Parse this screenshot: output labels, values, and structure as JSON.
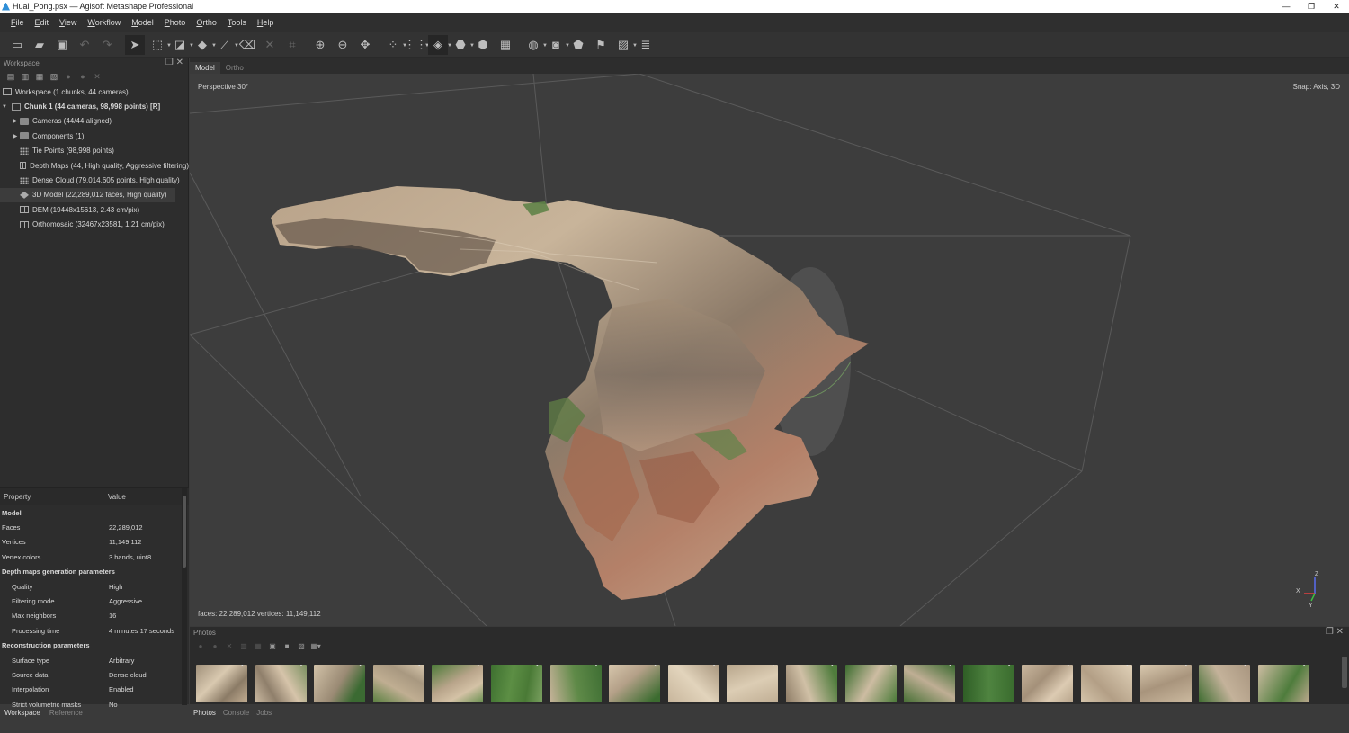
{
  "window": {
    "title": "Huai_Pong.psx — Agisoft Metashape Professional"
  },
  "menu": [
    "File",
    "Edit",
    "View",
    "Workflow",
    "Model",
    "Photo",
    "Ortho",
    "Tools",
    "Help"
  ],
  "toolbar_icons": [
    "new-icon",
    "open-icon",
    "save-icon",
    "undo-icon",
    "redo-icon",
    "navigation-icon",
    "rectangle-selection-icon",
    "shape-icon",
    "polygon-icon",
    "ruler-icon",
    "delete-icon",
    "crop-icon",
    "zoom-in-icon",
    "zoom-out-icon",
    "reset-view-icon",
    "point-cloud-icon",
    "dense-cloud-icon",
    "model-icon",
    "tiled-model-icon",
    "texture-icon",
    "dem-icon",
    "ortho-icon",
    "camera-icon",
    "shapes-icon",
    "markers-icon",
    "image-icon",
    "layers-icon"
  ],
  "workspace": {
    "panel_title": "Workspace",
    "root": "Workspace (1 chunks, 44 cameras)",
    "chunk": "Chunk 1 (44 cameras, 98,998 points) [R]",
    "items": [
      {
        "label": "Cameras (44/44 aligned)",
        "icon": "folder-icon",
        "expandable": true
      },
      {
        "label": "Components (1)",
        "icon": "folder-icon",
        "expandable": true
      },
      {
        "label": "Tie Points (98,998 points)",
        "icon": "tie-points-icon",
        "expandable": false
      },
      {
        "label": "Depth Maps (44, High quality, Aggressive filtering)",
        "icon": "depth-maps-icon",
        "expandable": false
      },
      {
        "label": "Dense Cloud (79,014,605 points, High quality)",
        "icon": "dense-cloud-icon",
        "expandable": false
      },
      {
        "label": "3D Model (22,289,012 faces, High quality)",
        "icon": "model-icon",
        "expandable": false,
        "selected": true
      },
      {
        "label": "DEM (19448x15613, 2.43 cm/pix)",
        "icon": "dem-icon",
        "expandable": false
      },
      {
        "label": "Orthomosaic (32467x23581, 1.21 cm/pix)",
        "icon": "orthomosaic-icon",
        "expandable": false
      }
    ]
  },
  "properties": {
    "col_property": "Property",
    "col_value": "Value",
    "rows": [
      {
        "k": "Model",
        "v": "",
        "type": "grp"
      },
      {
        "k": "Faces",
        "v": "22,289,012",
        "type": "sub"
      },
      {
        "k": "Vertices",
        "v": "11,149,112",
        "type": "sub"
      },
      {
        "k": "Vertex colors",
        "v": "3 bands, uint8",
        "type": "sub"
      },
      {
        "k": "Depth maps generation parameters",
        "v": "",
        "type": "grp"
      },
      {
        "k": "Quality",
        "v": "High",
        "type": "row"
      },
      {
        "k": "Filtering mode",
        "v": "Aggressive",
        "type": "row"
      },
      {
        "k": "Max neighbors",
        "v": "16",
        "type": "row"
      },
      {
        "k": "Processing time",
        "v": "4 minutes 17 seconds",
        "type": "row"
      },
      {
        "k": "Reconstruction parameters",
        "v": "",
        "type": "grp"
      },
      {
        "k": "Surface type",
        "v": "Arbitrary",
        "type": "row"
      },
      {
        "k": "Source data",
        "v": "Dense cloud",
        "type": "row"
      },
      {
        "k": "Interpolation",
        "v": "Enabled",
        "type": "row"
      },
      {
        "k": "Strict volumetric masks",
        "v": "No",
        "type": "row"
      }
    ]
  },
  "left_tabs": [
    "Workspace",
    "Reference"
  ],
  "view_tabs": [
    "Model",
    "Ortho"
  ],
  "viewport": {
    "projection": "Perspective 30°",
    "snap": "Snap: Axis, 3D",
    "stats": "faces: 22,289,012 vertices: 11,149,112",
    "axes": {
      "x": "X",
      "y": "Y",
      "z": "Z"
    }
  },
  "photos": {
    "panel_title": "Photos",
    "thumb_count": 19
  },
  "bottom_tabs": [
    "Photos",
    "Console",
    "Jobs"
  ],
  "colors": {
    "bg": "#3d3d3d",
    "panel": "#2d2d2d",
    "accent": "#2f8fd8"
  }
}
